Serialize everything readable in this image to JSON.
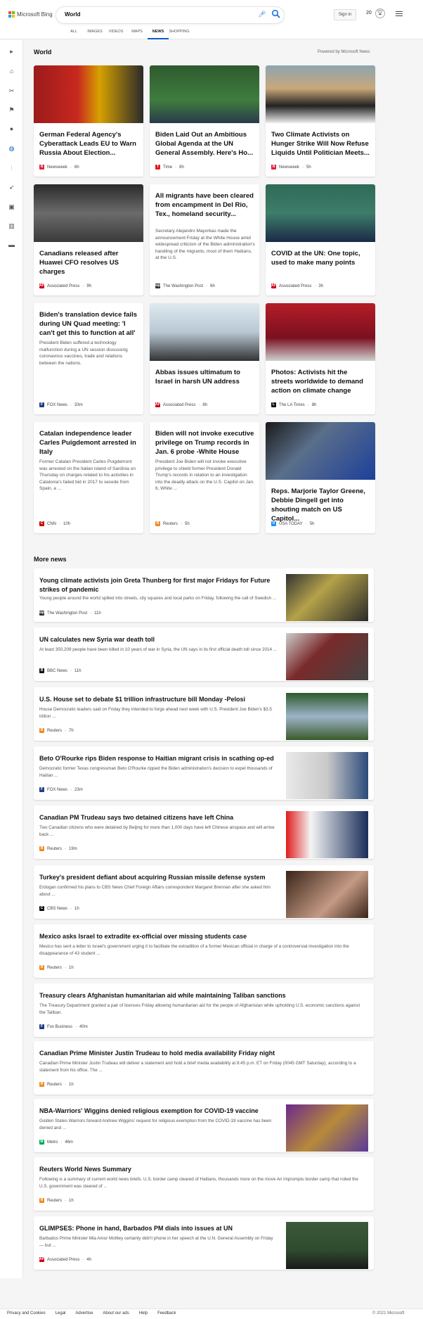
{
  "header": {
    "logo_text": "Microsoft Bing",
    "search_value": "World",
    "signin": "Sign in",
    "points": "20"
  },
  "tabs": [
    "ALL",
    "IMAGES",
    "VIDEOS",
    "MAPS",
    "NEWS",
    "SHOPPING"
  ],
  "world": {
    "title": "World",
    "powered": "Powered by Microsoft News"
  },
  "cards": [
    {
      "title": "German Federal Agency's Cyberattack Leads EU to Warn Russia About Election...",
      "snippet": "",
      "source": "Newsweek",
      "time": "6h",
      "src_color": "#e0223c",
      "src_letter": "N",
      "img": "flag"
    },
    {
      "title": "Biden Laid Out an Ambitious Global Agenda at the UN General Assembly. Here's Ho...",
      "snippet": "",
      "source": "Time",
      "time": "8h",
      "src_color": "#e01d1d",
      "src_letter": "T",
      "img": "podium"
    },
    {
      "title": "Two Climate Activists on Hunger Strike Will Now Refuse Liquids Until Politician Meets...",
      "snippet": "",
      "source": "Newsweek",
      "time": "5h",
      "src_color": "#e0223c",
      "src_letter": "N",
      "img": "protest"
    },
    {
      "title": "Canadians released after Huawei CFO resolves US charges",
      "snippet": "",
      "source": "Associated Press",
      "time": "9h",
      "src_color": "#d0021b",
      "src_letter": "AP",
      "img": "crowd"
    },
    {
      "title": "All migrants have been cleared from encampment in Del Rio, Tex., homeland security...",
      "snippet": "Secretary Alejandro Mayorkas made the announcement Friday at the White House amid widespread criticism of the Biden administration's handling of the migrants, most of them Haitians, at the U.S.",
      "source": "The Washington Post",
      "time": "6h",
      "src_color": "#333",
      "src_letter": "wp",
      "img": ""
    },
    {
      "title": "COVID at the UN: One topic, used to make many points",
      "snippet": "",
      "source": "Associated Press",
      "time": "3h",
      "src_color": "#d0021b",
      "src_letter": "AP",
      "img": "unspeaker"
    },
    {
      "title": "Biden's translation device fails during UN Quad meeting: 'I can't get this to function at all'",
      "snippet": "President Biden suffered a technology malfunction during a UN session discussing coronavirus vaccines, trade and relations between the nations.",
      "source": "FOX News",
      "time": "33m",
      "src_color": "#1f3c88",
      "src_letter": "F",
      "img": ""
    },
    {
      "title": "Abbas issues ultimatum to Israel in harsh UN address",
      "snippet": "",
      "source": "Associated Press",
      "time": "8h",
      "src_color": "#d0021b",
      "src_letter": "AP",
      "img": "abbas"
    },
    {
      "title": "Photos: Activists hit the streets worldwide to demand action on climate change",
      "snippet": "",
      "source": "The LA Times",
      "time": "8h",
      "src_color": "#111",
      "src_letter": "L",
      "img": "red"
    },
    {
      "title": "Catalan independence leader Carles Puigdemont arrested in Italy",
      "snippet": "Former Catalan President Carles Puigdemont was arrested on the Italian island of Sardinia on Thursday on charges related to his activities in Catalonia's failed bid in 2017 to secede from Spain, a ...",
      "source": "CNN",
      "time": "10h",
      "src_color": "#cc0000",
      "src_letter": "C",
      "img": ""
    },
    {
      "title": "Biden will not invoke executive privilege on Trump records in Jan. 6 probe -White House",
      "snippet": "President Joe Biden will not invoke executive privilege to shield former President Donald Trump's records in relation to an investigation into the deadly attack on the U.S. Capitol on Jan. 6, White ...",
      "source": "Reuters",
      "time": "5h",
      "src_color": "#f08a24",
      "src_letter": "R",
      "img": ""
    },
    {
      "title": "Reps. Marjorie Taylor Greene, Debbie Dingell get into shouting match on US Capitol...",
      "snippet": "",
      "source": "USA TODAY",
      "time": "5h",
      "src_color": "#1e90ff",
      "src_letter": "U",
      "img": "capitolsteps"
    }
  ],
  "more": {
    "title": "More news",
    "items": [
      {
        "title": "Young climate activists join Greta Thunberg for first major Fridays for Future strikes of pandemic",
        "snippet": "Young people around the world spilled into streets, city squares and local parks on Friday, following the call of Swedish ...",
        "source": "The Washington Post",
        "time": "11h",
        "src_color": "#333",
        "src_letter": "wp",
        "img": "protestrow"
      },
      {
        "title": "UN calculates new Syria war death toll",
        "snippet": "At least 350,209 people have been killed in 10 years of war in Syria, the UN says in its first official death toll since 2014 ...",
        "source": "BBC News",
        "time": "11h",
        "src_color": "#111",
        "src_letter": "B",
        "img": "syria"
      },
      {
        "title": "U.S. House set to debate $1 trillion infrastructure bill Monday -Pelosi",
        "snippet": "House Democratic leaders said on Friday they intended to forge ahead next week with U.S. President Joe Biden's $3.5 trillion ...",
        "source": "Reuters",
        "time": "7h",
        "src_color": "#f08a24",
        "src_letter": "R",
        "img": "capitol"
      },
      {
        "title": "Beto O'Rourke rips Biden response to Haitian migrant crisis in scathing op-ed",
        "snippet": "Democratic former Texas congressman Beto O'Rourke ripped the Biden administration's decision to expel thousands of Haitian ...",
        "source": "FOX News",
        "time": "23m",
        "src_color": "#1f3c88",
        "src_letter": "F",
        "img": "beto"
      },
      {
        "title": "Canadian PM Trudeau says two detained citizens have left China",
        "snippet": "Two Canadian citizens who were detained by Beijing for more than 1,000 days have left Chinese airspace and will arrive back ...",
        "source": "Reuters",
        "time": "19m",
        "src_color": "#f08a24",
        "src_letter": "R",
        "img": "trudeau"
      },
      {
        "title": "Turkey's president defiant about acquiring Russian missile defense system",
        "snippet": "Erdogan confirmed his plans to CBS News Chief Foreign Affairs correspondent Margaret Brennan after she asked him about ...",
        "source": "CBS News",
        "time": "1h",
        "src_color": "#111",
        "src_letter": "C",
        "img": "erdogan"
      },
      {
        "title": "Mexico asks Israel to extradite ex-official over missing students case",
        "snippet": "Mexico has sent a letter to Israel's government urging it to facilitate the extradition of a former Mexican official in charge of a controversial investigation into the disappearance of 43 student ...",
        "source": "Reuters",
        "time": "1h",
        "src_color": "#f08a24",
        "src_letter": "R",
        "img": ""
      },
      {
        "title": "Treasury clears Afghanistan humanitarian aid while maintaining Taliban sanctions",
        "snippet": "The Treasury Department granted a pair of licenses Friday allowing humanitarian aid for the people of Afghanistan while upholding U.S. economic sanctions against the Taliban.",
        "source": "Fox Business",
        "time": "40m",
        "src_color": "#1f3c88",
        "src_letter": "F",
        "img": ""
      },
      {
        "title": "Canadian Prime Minister Justin Trudeau to hold media availability Friday night",
        "snippet": "Canadian Prime Minister Justin Trudeau will deliver a statement and hold a brief media availability at 8:45 p.m. ET on Friday (0045 GMT Saturday), according to a statement from his office. The ...",
        "source": "Reuters",
        "time": "1h",
        "src_color": "#f08a24",
        "src_letter": "R",
        "img": ""
      },
      {
        "title": "NBA-Warriors' Wiggins denied religious exemption for COVID-19 vaccine",
        "snippet": "Golden States Warriors forward Andrew Wiggins' request for religious exemption from the COVID-19 vaccine has been denied and ...",
        "source": "Metro",
        "time": "46m",
        "src_color": "#00a651",
        "src_letter": "M",
        "img": "nba"
      },
      {
        "title": "Reuters World News Summary",
        "snippet": "Following is a summary of current world news briefs. U.S. border camp cleared of Haitians, thousands more on the move An impromptu border camp that roiled the U.S. government was cleared of ...",
        "source": "Reuters",
        "time": "1h",
        "src_color": "#f08a24",
        "src_letter": "R",
        "img": ""
      },
      {
        "title": "GLIMPSES: Phone in hand, Barbados PM dials into issues at UN",
        "snippet": "Barbados Prime Minister Mia Amor Mottley certainly didn't phone in her speech at the U.N. General Assembly on Friday — but ...",
        "source": "Associated Press",
        "time": "4h",
        "src_color": "#d0021b",
        "src_letter": "AP",
        "img": "barbados"
      }
    ]
  },
  "footer": {
    "links": [
      "Privacy and Cookies",
      "Legal",
      "Advertise",
      "About our ads",
      "Help",
      "Feedback"
    ],
    "copyright": "© 2021 Microsoft"
  }
}
